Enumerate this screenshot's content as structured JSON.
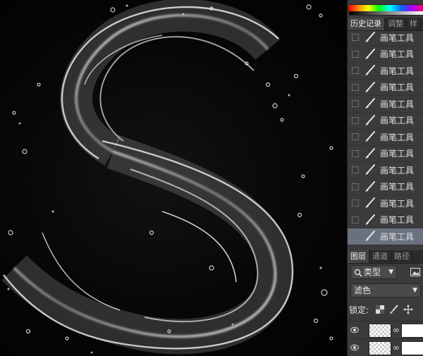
{
  "panel": {
    "history_tabs": [
      {
        "label": "历史记录",
        "active": true
      },
      {
        "label": "调整",
        "active": false
      },
      {
        "label": "样",
        "active": false
      }
    ],
    "history_items": [
      {
        "label": "画笔工具",
        "selected": false
      },
      {
        "label": "画笔工具",
        "selected": false
      },
      {
        "label": "画笔工具",
        "selected": false
      },
      {
        "label": "画笔工具",
        "selected": false
      },
      {
        "label": "画笔工具",
        "selected": false
      },
      {
        "label": "画笔工具",
        "selected": false
      },
      {
        "label": "画笔工具",
        "selected": false
      },
      {
        "label": "画笔工具",
        "selected": false
      },
      {
        "label": "画笔工具",
        "selected": false
      },
      {
        "label": "画笔工具",
        "selected": false
      },
      {
        "label": "画笔工具",
        "selected": false
      },
      {
        "label": "画笔工具",
        "selected": false
      },
      {
        "label": "画笔工具",
        "selected": true
      }
    ],
    "layer_tabs": [
      {
        "label": "图层",
        "active": true
      },
      {
        "label": "通道",
        "active": false
      },
      {
        "label": "路径",
        "active": false
      }
    ],
    "filter_kind": "类型",
    "blend_mode": "滤色",
    "lock_label": "锁定:"
  },
  "colors": {
    "panel_bg": "#3b3b3b",
    "selected_row": "#6a7280"
  },
  "icons": {
    "search": "search-icon",
    "brush": "brush-icon",
    "image_filter": "image-filter-icon",
    "lock_pixels": "lock-transparent-icon",
    "lock_paint": "lock-paint-icon",
    "lock_move": "lock-move-icon",
    "eye": "eye-icon",
    "chain": "chain-link-icon"
  }
}
